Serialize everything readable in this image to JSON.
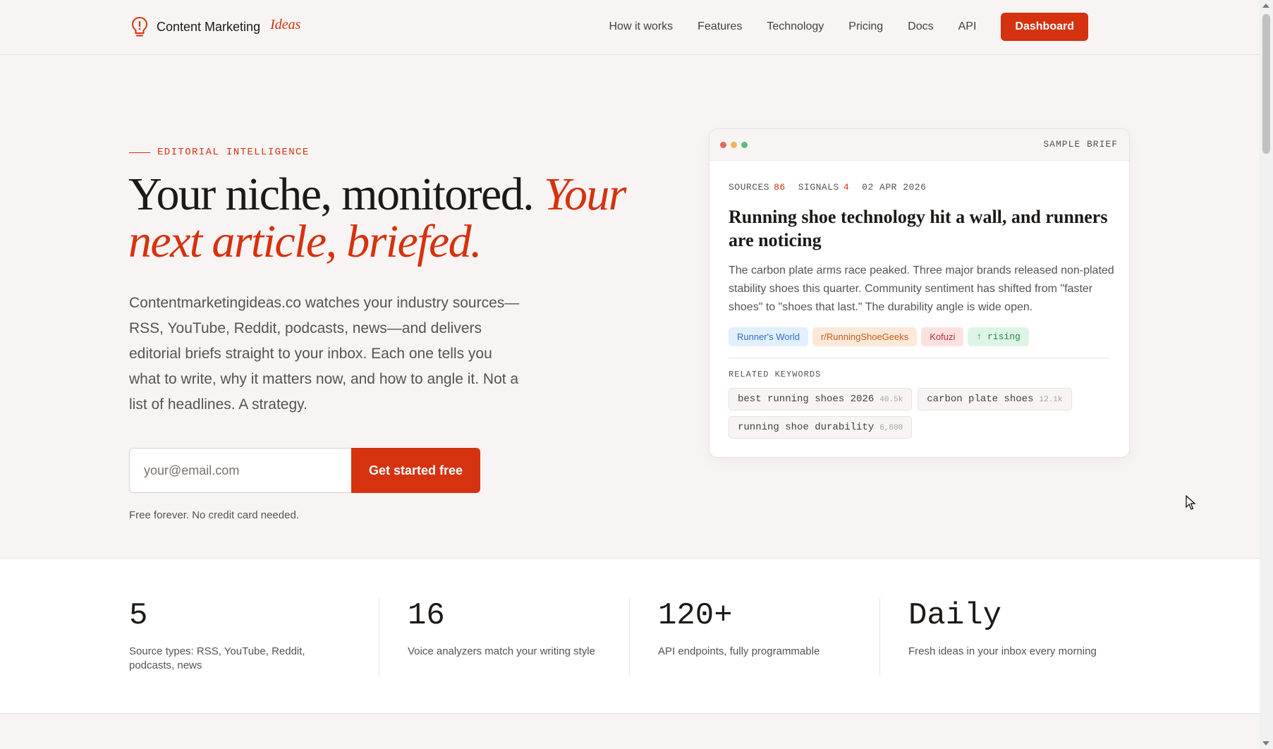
{
  "nav": {
    "brand": "Content Marketing",
    "brand_accent": "Ideas",
    "links": [
      "How it works",
      "Features",
      "Technology",
      "Pricing",
      "Docs",
      "API"
    ],
    "dashboard_label": "Dashboard"
  },
  "hero": {
    "eyebrow": "EDITORIAL INTELLIGENCE",
    "headline_plain": "Your niche, monitored.",
    "headline_accent": "Your next article, briefed.",
    "lede": "Contentmarketingideas.co watches your industry sources—RSS, YouTube, Reddit, podcasts, news—and delivers editorial briefs straight to your inbox. Each one tells you what to write, why it matters now, and how to angle it. Not a list of headlines. A strategy.",
    "email_placeholder": "your@email.com",
    "cta_label": "Get started free",
    "note": "Free forever. No credit card needed."
  },
  "brief": {
    "window_label": "SAMPLE BRIEF",
    "sources_label": "SOURCES",
    "sources_count": "86",
    "signals_label": "SIGNALS",
    "signals_count": "4",
    "date": "02 APR 2026",
    "title": "Running shoe technology hit a wall, and runners are noticing",
    "body": "The carbon plate arms race peaked. Three major brands released non-plated stability shoes this quarter. Community sentiment has shifted from \"faster shoes\" to \"shoes that last.\" The durability angle is wide open.",
    "tags": [
      "Runner's World",
      "r/RunningShoeGeeks",
      "Kofuzi",
      "↑ rising"
    ],
    "keywords_label": "RELATED KEYWORDS",
    "keywords": [
      {
        "term": "best running shoes 2026",
        "volume": "40.5k"
      },
      {
        "term": "carbon plate shoes",
        "volume": "12.1k"
      },
      {
        "term": "running shoe durability",
        "volume": "6,800"
      }
    ]
  },
  "stats": [
    {
      "value": "5",
      "label": "Source types: RSS, YouTube, Reddit, podcasts, news"
    },
    {
      "value": "16",
      "label": "Voice analyzers match your writing style"
    },
    {
      "value": "120+",
      "label": "API endpoints, fully programmable"
    },
    {
      "value": "Daily",
      "label": "Fresh ideas in your inbox every morning"
    }
  ],
  "colors": {
    "accent": "#d5320f",
    "background": "#f8f4f3",
    "text": "#1c1917"
  }
}
